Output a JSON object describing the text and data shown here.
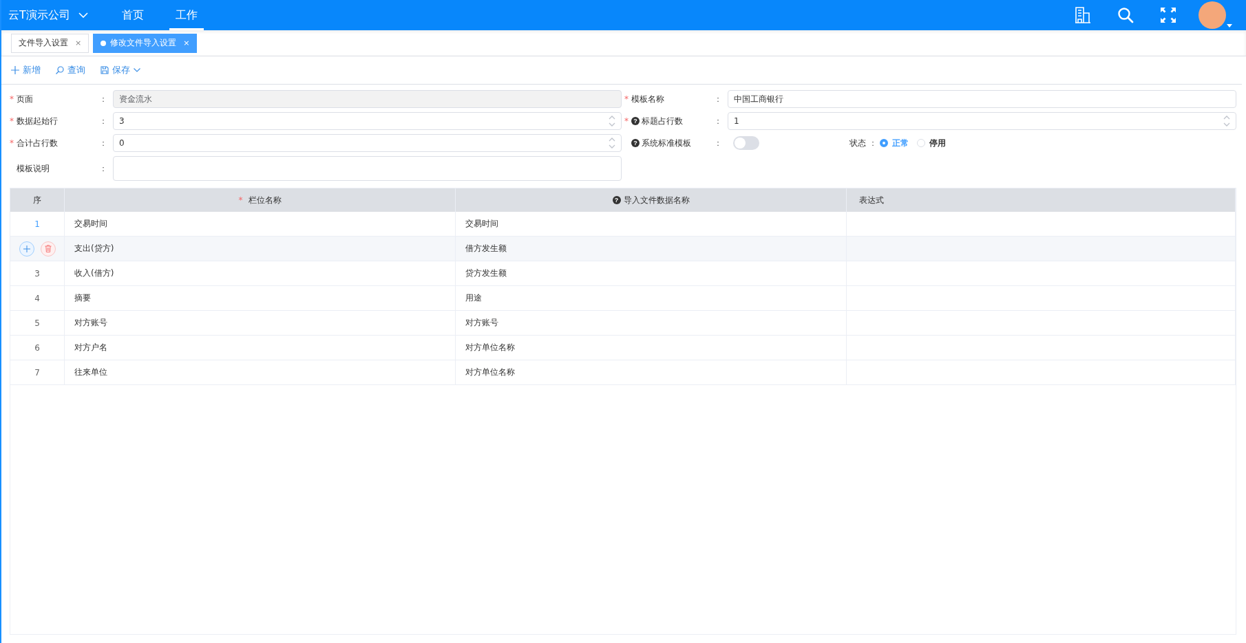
{
  "header": {
    "company": "云T演示公司",
    "nav": [
      {
        "label": "首页",
        "selected": false
      },
      {
        "label": "工作",
        "selected": true
      }
    ]
  },
  "tabs": [
    {
      "label": "文件导入设置",
      "selected": false,
      "close": "×"
    },
    {
      "label": "修改文件导入设置",
      "selected": true,
      "close": "×"
    }
  ],
  "toolbar": [
    {
      "kind": "add",
      "label": "新增"
    },
    {
      "kind": "search",
      "label": "查询"
    },
    {
      "kind": "save",
      "label": "保存"
    }
  ],
  "form": {
    "rows": [
      {
        "fields": [
          {
            "kind": "text",
            "required": "*",
            "label": "页面",
            "colon": "：",
            "value": "资金流水",
            "disabled": true
          },
          {
            "kind": "text",
            "required": "*",
            "label": "模板名称",
            "colon": "：",
            "value": "中国工商银行",
            "disabled": false
          }
        ]
      },
      {
        "fields": [
          {
            "kind": "number",
            "required": "*",
            "label": "数据起始行",
            "colon": "：",
            "value": "3",
            "disabled": false
          },
          {
            "kind": "number",
            "required": "*",
            "help": "?",
            "label": "标题占行数",
            "colon": "：",
            "value": "1",
            "disabled": false
          }
        ]
      },
      {
        "fields": [
          {
            "kind": "number",
            "required": "*",
            "label": "合计占行数",
            "colon": "：",
            "value": "0",
            "disabled": false
          },
          {
            "kind": "switch",
            "help": "?",
            "label": "系统标准模板",
            "colon": "：",
            "on": false
          },
          {
            "kind": "radio",
            "label": "状态",
            "colon": "：",
            "options": [
              {
                "label": "正常",
                "selected": true
              },
              {
                "label": "停用",
                "selected": false
              }
            ]
          }
        ]
      },
      {
        "fields": [
          {
            "kind": "textarea",
            "label": "模板说明",
            "colon": "：",
            "disabled": false
          }
        ]
      }
    ]
  },
  "table": {
    "columns": [
      {
        "label": "序"
      },
      {
        "required": "*",
        "label": "栏位名称"
      },
      {
        "help": "?",
        "label": "导入文件数据名称"
      },
      {
        "label": "表达式"
      }
    ],
    "rows": [
      {
        "kind": "link",
        "seq": "1",
        "cells": [
          "交易时间",
          "交易时间"
        ]
      },
      {
        "kind": "actions",
        "cells": [
          "支出(贷方)",
          "借方发生额"
        ]
      },
      {
        "kind": "number",
        "seq": "3",
        "cells": [
          "收入(借方)",
          "贷方发生额"
        ]
      },
      {
        "kind": "number",
        "seq": "4",
        "cells": [
          "摘要",
          "用途"
        ]
      },
      {
        "kind": "number",
        "seq": "5",
        "cells": [
          "对方账号",
          "对方账号"
        ]
      },
      {
        "kind": "number",
        "seq": "6",
        "cells": [
          "对方户名",
          "对方单位名称"
        ]
      },
      {
        "kind": "number",
        "seq": "7",
        "cells": [
          "往来单位",
          "对方单位名称"
        ]
      }
    ]
  }
}
